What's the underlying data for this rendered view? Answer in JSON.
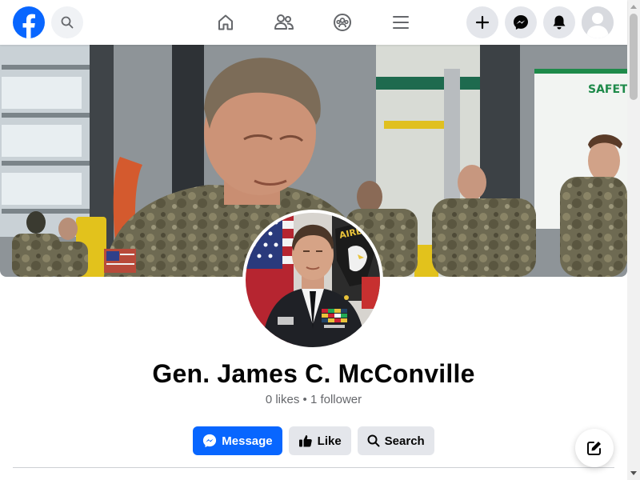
{
  "topbar": {
    "logo_icon": "facebook-logo-icon",
    "search_icon": "search-icon",
    "nav": [
      {
        "name": "home",
        "icon": "home-icon"
      },
      {
        "name": "friends",
        "icon": "friends-icon"
      },
      {
        "name": "groups",
        "icon": "groups-icon"
      },
      {
        "name": "menu",
        "icon": "hamburger-menu-icon"
      }
    ],
    "right": [
      {
        "name": "create",
        "icon": "plus-icon"
      },
      {
        "name": "messenger",
        "icon": "messenger-icon"
      },
      {
        "name": "notifications",
        "icon": "bell-icon"
      },
      {
        "name": "account",
        "icon": "default-avatar-icon"
      }
    ]
  },
  "profile": {
    "name": "Gen. James C. McConville",
    "stats": "0 likes • 1 follower"
  },
  "actions": {
    "message_label": "Message",
    "like_label": "Like",
    "search_label": "Search"
  },
  "colors": {
    "brand": "#0866ff",
    "secondary_bg": "#e4e6eb",
    "muted_text": "#65676b"
  }
}
